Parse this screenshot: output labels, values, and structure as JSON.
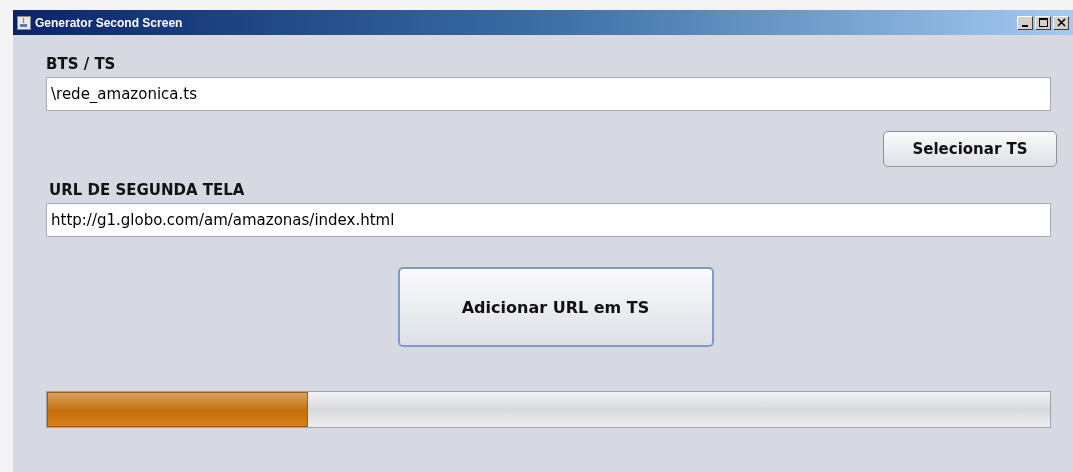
{
  "window": {
    "title": "Generator Second Screen"
  },
  "bts_field": {
    "label": "BTS / TS",
    "value": "\\rede_amazonica.ts"
  },
  "select_button": "Selecionar TS",
  "url_field": {
    "label": "URL DE SEGUNDA TELA",
    "value": "http://g1.globo.com/am/amazonas/index.html"
  },
  "add_button": "Adicionar URL em TS",
  "progress": {
    "level": 0.26
  }
}
